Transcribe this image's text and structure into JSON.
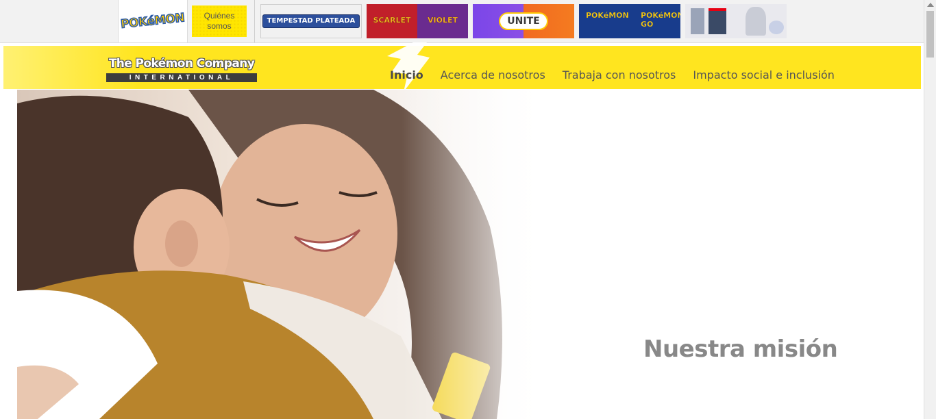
{
  "game_bar": {
    "home_logo": "POKéMON",
    "about_label": "Quiénes somos",
    "tiles": [
      {
        "name": "tempestad-plateada",
        "label": "TEMPESTAD PLATEADA"
      },
      {
        "name": "scarlet-violet",
        "label_1": "SCARLET",
        "label_2": "VIOLET"
      },
      {
        "name": "pokemon-unite",
        "label": "UNITE"
      },
      {
        "name": "pokemon-go",
        "label_1": "POKéMON",
        "label_2": "POKéMON GO"
      },
      {
        "name": "legends-arceus",
        "label": ""
      }
    ]
  },
  "header": {
    "logo_name": "The Pokémon Company",
    "logo_sub": "INTERNATIONAL",
    "nav": [
      {
        "label": "Inicio",
        "active": true
      },
      {
        "label": "Acerca de nosotros",
        "active": false
      },
      {
        "label": "Trabaja con nosotros",
        "active": false
      },
      {
        "label": "Impacto social e inclusión",
        "active": false
      }
    ]
  },
  "hero": {
    "heading": "Nuestra misión"
  },
  "colors": {
    "header_yellow": "#ffe51f",
    "heading_gray": "#888888",
    "nav_text": "#555555"
  }
}
